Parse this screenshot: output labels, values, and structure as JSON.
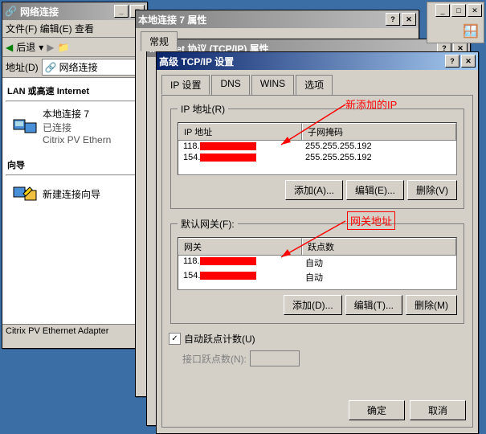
{
  "win1": {
    "title": "网络连接",
    "menu": "文件(F)  编辑(E)  查看",
    "toolbar_back": "后退",
    "addr_label": "地址(D)",
    "addr_value": "网络连接",
    "section1": "LAN 或高速 Internet",
    "conn_name": "本地连接 7",
    "conn_status": "已连接",
    "conn_device": "Citrix PV Ethern",
    "section2": "向导",
    "wizard": "新建连接向导",
    "status": "Citrix PV Ethernet Adapter"
  },
  "win2": {
    "title": "本地连接 7 属性",
    "tab1": "常规"
  },
  "win3": {
    "title": "Internet 协议 (TCP/IP) 属性"
  },
  "win4": {
    "title": "高级 TCP/IP 设置",
    "tabs": [
      "IP 设置",
      "DNS",
      "WINS",
      "选项"
    ],
    "group1_title": "IP 地址(R)",
    "group1_col1": "IP 地址",
    "group1_col2": "子网掩码",
    "ips": [
      {
        "ip_prefix": "118.",
        "mask": "255.255.255.192"
      },
      {
        "ip_prefix": "154.",
        "mask": "255.255.255.192"
      }
    ],
    "btn_add": "添加(A)...",
    "btn_edit": "编辑(E)...",
    "btn_del": "删除(V)",
    "group2_title": "默认网关(F):",
    "group2_col1": "网关",
    "group2_col2": "跃点数",
    "gws": [
      {
        "gw_prefix": "118.",
        "metric": "自动"
      },
      {
        "gw_prefix": "154.",
        "metric": "自动"
      }
    ],
    "btn_add2": "添加(D)...",
    "btn_edit2": "编辑(T)...",
    "btn_del2": "删除(M)",
    "auto_metric": "自动跃点计数(U)",
    "iface_metric": "接口跃点数(N):",
    "ok": "确定",
    "cancel": "取消"
  },
  "anno": {
    "new_ip": "新添加的IP",
    "gateway": "网关地址"
  }
}
